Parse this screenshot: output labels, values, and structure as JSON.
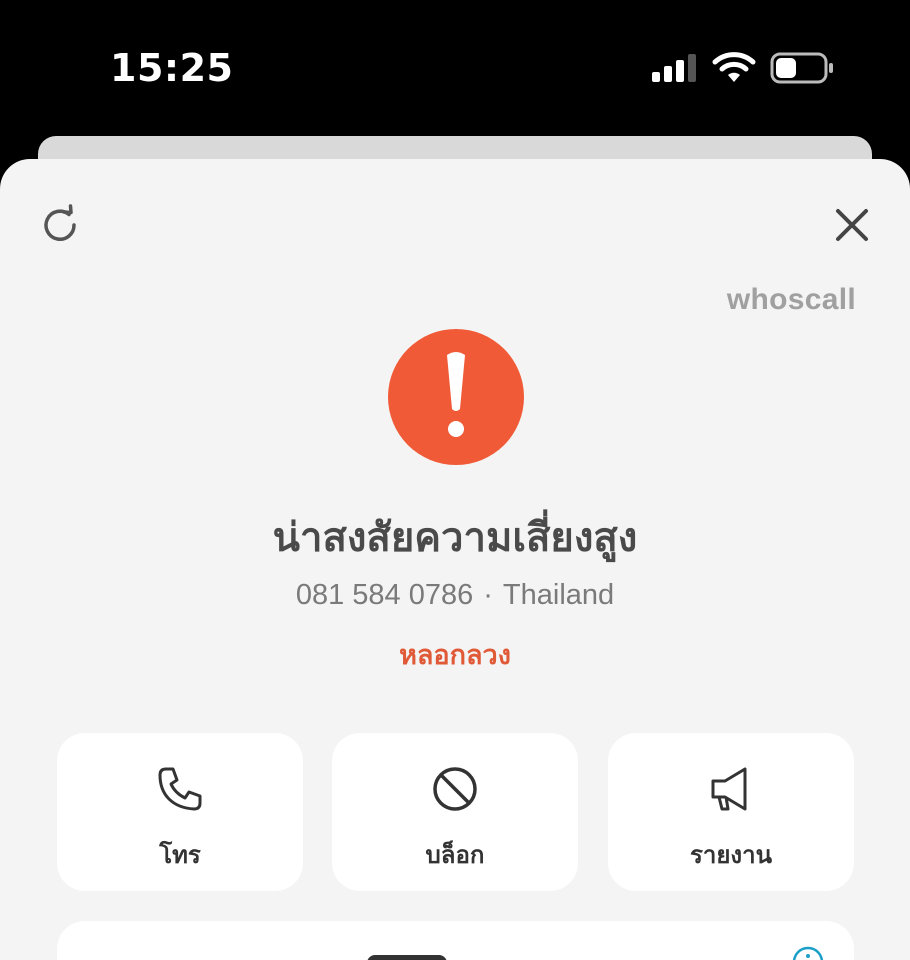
{
  "status_bar": {
    "time": "15:25"
  },
  "header": {
    "brand": "whoscall"
  },
  "result": {
    "risk_label": "น่าสงสัยความเสี่ยงสูง",
    "phone_number": "081 584 0786",
    "separator": "·",
    "country": "Thailand",
    "category": "หลอกลวง"
  },
  "actions": [
    {
      "label": "โทร",
      "icon": "phone-icon"
    },
    {
      "label": "บล็อก",
      "icon": "block-icon"
    },
    {
      "label": "รายงาน",
      "icon": "megaphone-icon"
    }
  ],
  "colors": {
    "warning": "#f05a36",
    "category_text": "#e05a38",
    "brand_text": "#a0a0a0"
  }
}
